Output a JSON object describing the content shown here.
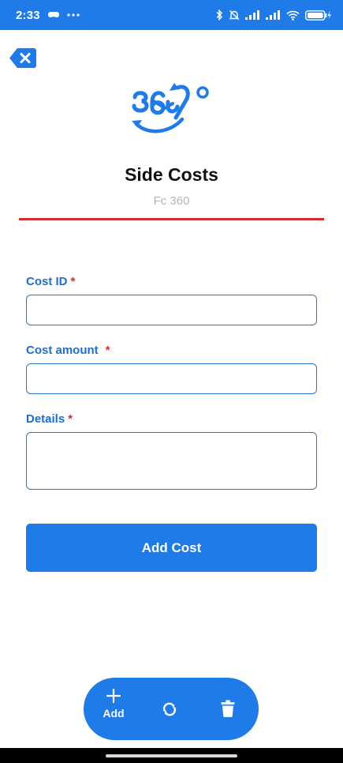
{
  "status_bar": {
    "time": "2:33",
    "left_icons": [
      "game-controller-icon",
      "more-dots-icon"
    ],
    "right_icons": [
      "bluetooth-icon",
      "bell-muted-icon",
      "signal-icon",
      "signal-icon",
      "wifi-icon",
      "battery-icon"
    ],
    "background": "#1f7be7"
  },
  "header": {
    "logo_icon": "360-logo-icon",
    "title": "Side Costs",
    "subtitle": "Fc 360"
  },
  "form": {
    "fields": [
      {
        "label": "Cost ID",
        "required_mark": "*",
        "value": "",
        "placeholder": ""
      },
      {
        "label": "Cost amount",
        "required_mark": "*",
        "value": "",
        "placeholder": ""
      },
      {
        "label": "Details",
        "required_mark": "*",
        "value": "",
        "placeholder": ""
      }
    ],
    "submit_label": "Add Cost"
  },
  "fab": {
    "add_label": "Add",
    "icons": [
      "plus-icon",
      "refresh-icon",
      "trash-icon"
    ]
  },
  "colors": {
    "primary": "#1f7be7",
    "label": "#1f6fc8",
    "accent_red": "#d32f2f",
    "subtitle": "#b5b5b5"
  }
}
